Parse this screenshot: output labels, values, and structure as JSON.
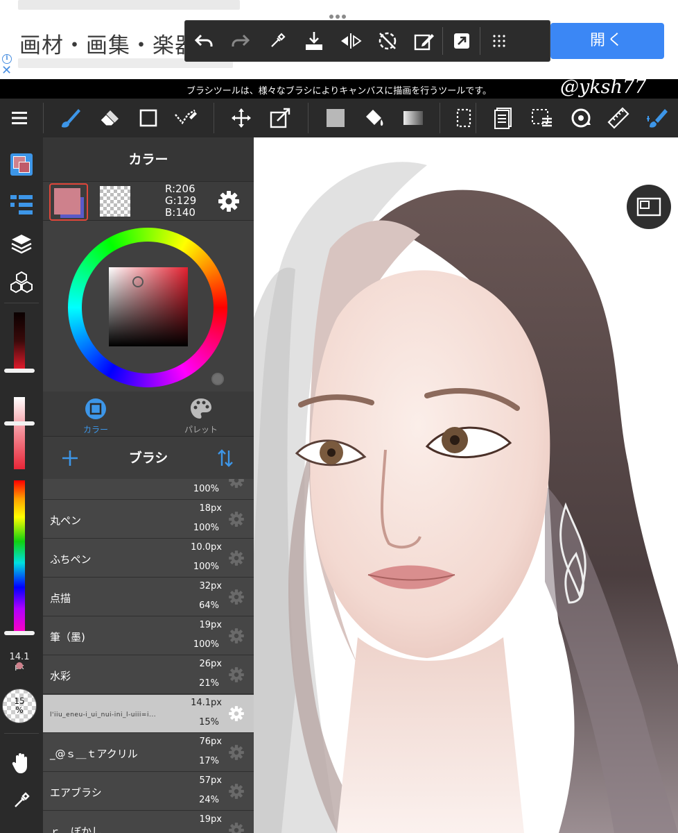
{
  "ad": {
    "headline": "画材・画集・楽器",
    "open_button": "開く",
    "info_icon": "info-icon",
    "close_icon": "close-icon"
  },
  "quickbar": {
    "items": [
      "undo-icon",
      "redo-icon",
      "eyedropper-icon",
      "save-icon",
      "flip-horizontal-icon",
      "rotate-reset-icon",
      "edit-layer-icon",
      "share-icon",
      "more-icon"
    ]
  },
  "tip": {
    "text": "ブラシツールは、様々なブラシによりキャンバスに描画を行うツールです。"
  },
  "watermark": "@yksh77",
  "toolbar": {
    "items": [
      "menu-icon",
      "brush-icon",
      "eraser-icon",
      "shape-icon",
      "select-pen-icon",
      "move-icon",
      "transform-icon",
      "fill-color-icon",
      "bucket-icon",
      "gradient-icon",
      "lasso-select-icon",
      "layer-list-icon",
      "select-all-icon",
      "rotate-icon",
      "ruler-icon",
      "snap-brush-icon"
    ]
  },
  "rail": {
    "brush_size": "14.1",
    "brush_size_unit": "px",
    "opacity": "15",
    "opacity_unit": "%",
    "dark_knob_level": 0.98,
    "light_knob_level": 0.38,
    "hue_knob_level": 1.0
  },
  "color_panel": {
    "title": "カラー",
    "r": "R:206",
    "g": "G:129",
    "b": "B:140",
    "current_color": "#ce818c",
    "tab_color": "カラー",
    "tab_palette": "パレット",
    "accent": "#3b87f5"
  },
  "brush_panel": {
    "title": "ブラシ",
    "brushes": [
      {
        "name": "",
        "size": "",
        "opacity": "100%"
      },
      {
        "name": "丸ペン",
        "size": "18px",
        "opacity": "100%"
      },
      {
        "name": "ふちペン",
        "size": "10.0px",
        "opacity": "100%"
      },
      {
        "name": "点描",
        "size": "32px",
        "opacity": "64%"
      },
      {
        "name": "筆（墨)",
        "size": "19px",
        "opacity": "100%"
      },
      {
        "name": "水彩",
        "size": "26px",
        "opacity": "21%"
      },
      {
        "name": "l'iiu_eneu-i_ui_nui-ini_l-uiii=i...",
        "size": "14.1px",
        "opacity": "15%"
      },
      {
        "name": "_@ｓ＿ｔアクリル",
        "size": "76px",
        "opacity": "17%"
      },
      {
        "name": "エアブラシ",
        "size": "57px",
        "opacity": "24%"
      },
      {
        "name": "ｒ＿ぼかし",
        "size": "19px",
        "opacity": ""
      }
    ]
  }
}
